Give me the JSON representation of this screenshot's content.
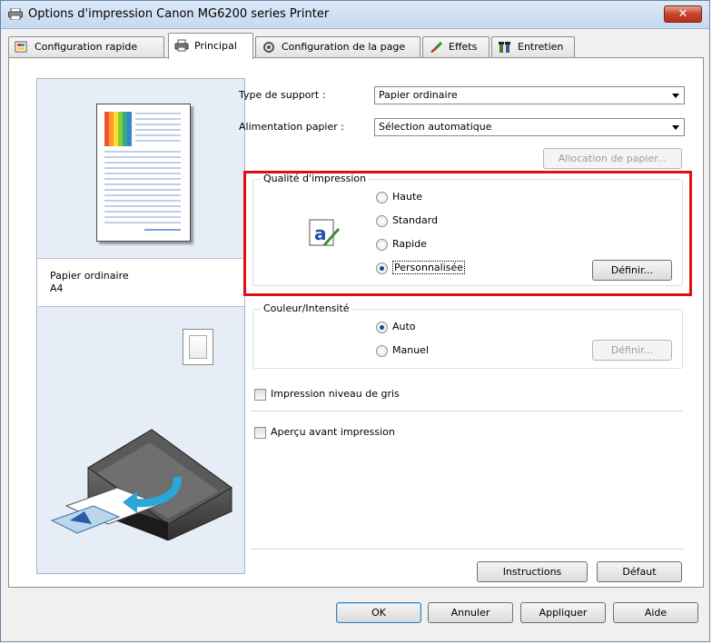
{
  "window": {
    "title": "Options d'impression Canon MG6200 series Printer",
    "close_label": "✕"
  },
  "tabs": [
    {
      "label": "Configuration rapide",
      "icon": "quick-setup-icon",
      "active": false
    },
    {
      "label": "Principal",
      "icon": "main-printer-icon",
      "active": true
    },
    {
      "label": "Configuration de la page",
      "icon": "page-setup-icon",
      "active": false
    },
    {
      "label": "Effets",
      "icon": "effects-brush-icon",
      "active": false
    },
    {
      "label": "Entretien",
      "icon": "maintenance-tools-icon",
      "active": false
    }
  ],
  "preview": {
    "media_line1": "Papier ordinaire",
    "media_line2": "A4"
  },
  "media": {
    "type_label": "Type de support :",
    "type_value": "Papier ordinaire",
    "source_label": "Alimentation papier :",
    "source_value": "Sélection automatique",
    "allocation_button": "Allocation de papier..."
  },
  "quality": {
    "title": "Qualité d'impression",
    "options": [
      "Haute",
      "Standard",
      "Rapide",
      "Personnalisée"
    ],
    "selected": "Personnalisée",
    "set_button": "Définir..."
  },
  "color": {
    "title": "Couleur/Intensité",
    "options": [
      "Auto",
      "Manuel"
    ],
    "selected": "Auto",
    "set_button": "Définir..."
  },
  "grayscale_label": "Impression niveau de gris",
  "preview_before_label": "Aperçu avant impression",
  "instructions_button": "Instructions",
  "default_button": "Défaut",
  "footer": {
    "ok": "OK",
    "cancel": "Annuler",
    "apply": "Appliquer",
    "help": "Aide"
  },
  "colors": {
    "highlight": "#e01010",
    "accent": "#1a4a8a"
  }
}
